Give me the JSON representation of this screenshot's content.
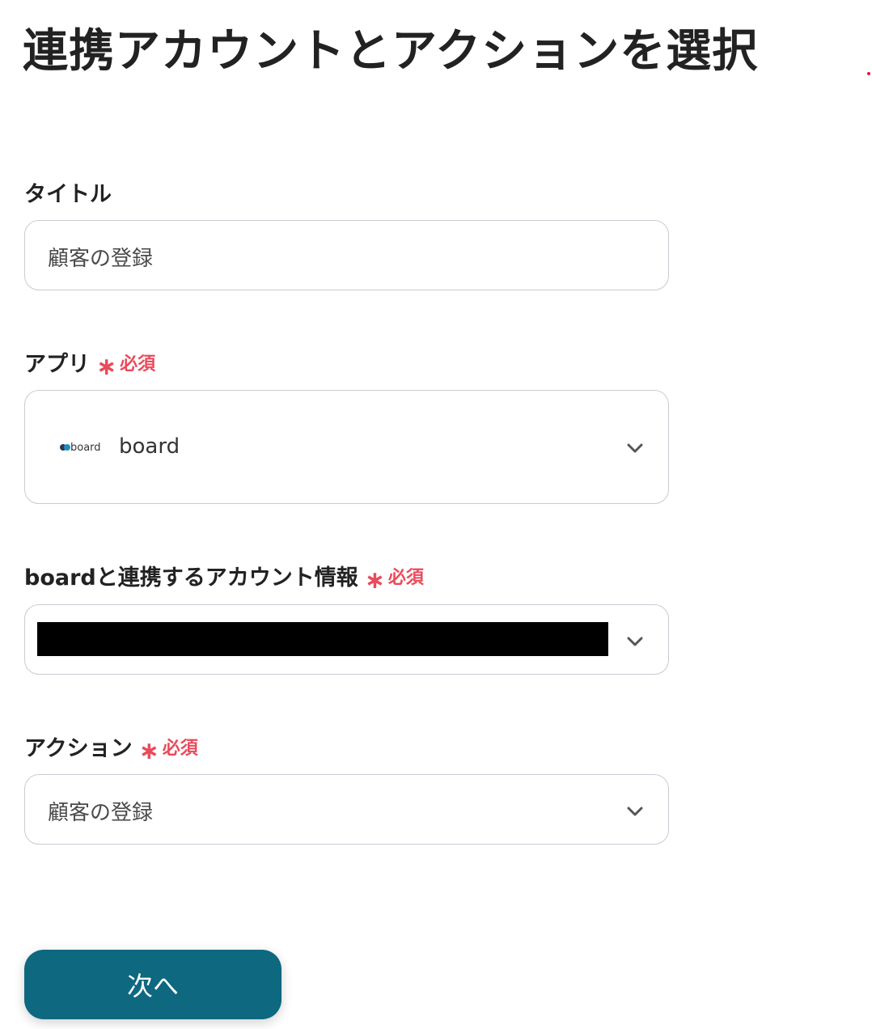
{
  "page": {
    "title": "連携アカウントとアクションを選択"
  },
  "required": {
    "asterisk": "∗",
    "text": "必須"
  },
  "fields": {
    "title": {
      "label": "タイトル",
      "value": "顧客の登録"
    },
    "app": {
      "label": "アプリ",
      "logo_text": "board",
      "value": "board",
      "icon": "chevron-down-icon"
    },
    "account": {
      "label": "boardと連携するアカウント情報",
      "value": "",
      "redacted": true,
      "icon": "chevron-down-icon"
    },
    "action": {
      "label": "アクション",
      "value": "顧客の登録",
      "icon": "chevron-down-icon"
    }
  },
  "buttons": {
    "next_label": "次へ"
  },
  "colors": {
    "primary_button": "#0d6880",
    "required": "#ea4a5a",
    "border": "#c9cbd3",
    "title_text": "#222222"
  }
}
